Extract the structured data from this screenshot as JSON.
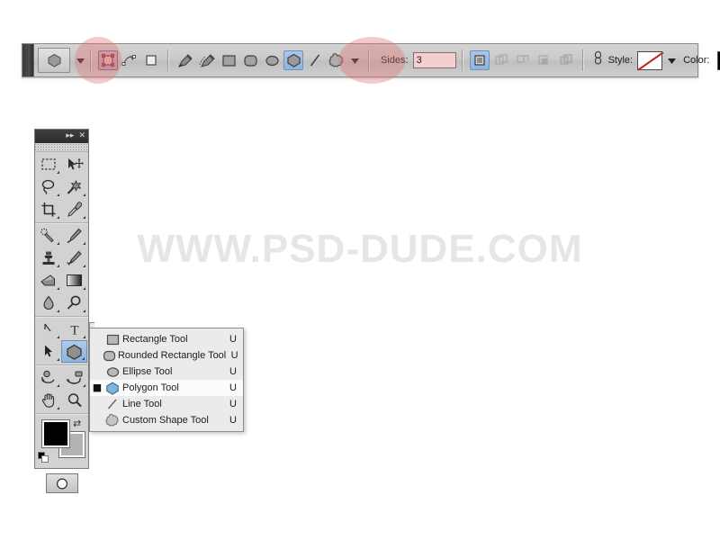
{
  "watermark": {
    "text": "WWW.PSD-DUDE.COM"
  },
  "options_bar": {
    "current_tool_icon": "polygon-shape-icon",
    "tool_preset_caret": "caret-down-icon",
    "shape_modes": [
      {
        "name": "shape-layers-mode",
        "icon": "shape-layer-icon",
        "state": "active",
        "highlighted": true
      },
      {
        "name": "paths-mode",
        "icon": "paths-icon",
        "state": "normal",
        "highlighted": false
      },
      {
        "name": "fill-pixels-mode",
        "icon": "fill-pixels-icon",
        "state": "normal",
        "highlighted": false
      }
    ],
    "tool_buttons": [
      {
        "name": "pen-tool",
        "icon": "pen-icon",
        "state": "normal"
      },
      {
        "name": "freeform-pen-tool",
        "icon": "freeform-pen-icon",
        "state": "normal"
      },
      {
        "name": "rectangle-tool",
        "icon": "rectangle-icon",
        "state": "normal"
      },
      {
        "name": "rounded-rectangle-tool",
        "icon": "rounded-rectangle-icon",
        "state": "normal"
      },
      {
        "name": "ellipse-tool",
        "icon": "ellipse-icon",
        "state": "normal"
      },
      {
        "name": "polygon-tool",
        "icon": "polygon-icon",
        "state": "active"
      },
      {
        "name": "line-tool",
        "icon": "line-icon",
        "state": "normal"
      },
      {
        "name": "custom-shape-tool",
        "icon": "custom-shape-icon",
        "state": "normal"
      }
    ],
    "geometry_caret": "caret-down-icon",
    "sides": {
      "label": "Sides:",
      "value": "3",
      "placeholder": "3",
      "highlighted": true
    },
    "combine_buttons": [
      {
        "name": "add-to-shape-area",
        "icon": "combine-new-icon",
        "state": "active"
      },
      {
        "name": "subtract-from-shape-area",
        "icon": "combine-add-icon",
        "state": "disabled"
      },
      {
        "name": "intersect-shape-areas",
        "icon": "combine-subtract-icon",
        "state": "disabled"
      },
      {
        "name": "exclude-overlapping-shape-areas",
        "icon": "combine-intersect-icon",
        "state": "disabled"
      },
      {
        "name": "combine-exclude",
        "icon": "combine-exclude-icon",
        "state": "disabled"
      }
    ],
    "layer_style_link": {
      "name": "link-styles-icon",
      "icon": "chain-link-icon"
    },
    "style": {
      "label": "Style:",
      "swatch": "none-crossed-out",
      "caret": "caret-down-icon"
    },
    "color": {
      "label": "Color:",
      "value": "#000000"
    }
  },
  "tools_panel": {
    "titlebar": {
      "collapse": "▸▸",
      "close": "✕"
    },
    "groups": [
      {
        "rows": [
          [
            {
              "name": "rectangular-marquee-tool",
              "icon": "marquee-icon",
              "has_flyout": true
            },
            {
              "name": "move-tool",
              "icon": "move-icon",
              "has_flyout": false
            }
          ],
          [
            {
              "name": "lasso-tool",
              "icon": "lasso-icon",
              "has_flyout": true
            },
            {
              "name": "magic-wand-tool",
              "icon": "magic-wand-icon",
              "has_flyout": true
            }
          ],
          [
            {
              "name": "crop-tool",
              "icon": "crop-icon",
              "has_flyout": true
            },
            {
              "name": "eyedropper-tool",
              "icon": "eyedropper-icon",
              "has_flyout": true
            }
          ]
        ]
      },
      {
        "rows": [
          [
            {
              "name": "healing-brush-tool",
              "icon": "healing-brush-icon",
              "has_flyout": true
            },
            {
              "name": "brush-tool",
              "icon": "brush-icon",
              "has_flyout": true
            }
          ],
          [
            {
              "name": "clone-stamp-tool",
              "icon": "clone-stamp-icon",
              "has_flyout": true
            },
            {
              "name": "history-brush-tool",
              "icon": "history-brush-icon",
              "has_flyout": true
            }
          ],
          [
            {
              "name": "eraser-tool",
              "icon": "eraser-icon",
              "has_flyout": true
            },
            {
              "name": "gradient-tool",
              "icon": "gradient-icon",
              "has_flyout": true
            }
          ],
          [
            {
              "name": "blur-tool",
              "icon": "blur-icon",
              "has_flyout": true
            },
            {
              "name": "dodge-tool",
              "icon": "dodge-icon",
              "has_flyout": true
            }
          ]
        ]
      },
      {
        "rows": [
          [
            {
              "name": "path-selection-tool",
              "icon": "pen-path-icon",
              "has_flyout": true
            },
            {
              "name": "type-tool",
              "icon": "type-icon",
              "has_flyout": true
            }
          ],
          [
            {
              "name": "direct-selection-tool",
              "icon": "arrow-select-icon",
              "has_flyout": true
            },
            {
              "name": "shape-tool",
              "icon": "polygon-icon",
              "has_flyout": true,
              "selected": true
            }
          ]
        ]
      },
      {
        "rows": [
          [
            {
              "name": "3d-rotate-tool",
              "icon": "3d-object-rotate-icon",
              "has_flyout": true
            },
            {
              "name": "3d-orbit-tool",
              "icon": "3d-camera-orbit-icon",
              "has_flyout": true
            }
          ],
          [
            {
              "name": "hand-tool",
              "icon": "hand-icon",
              "has_flyout": true
            },
            {
              "name": "zoom-tool",
              "icon": "zoom-magnifier-icon",
              "has_flyout": false
            }
          ]
        ]
      }
    ],
    "colors": {
      "foreground": "#000000",
      "background": "#b3b3b3",
      "swap_icon": "swap-colors-icon",
      "default_icon": "default-colors-icon"
    },
    "quickmask": {
      "name": "quick-mask-mode-icon"
    }
  },
  "flyout_menu": {
    "items": [
      {
        "label": "Rectangle Tool",
        "shortcut": "U",
        "icon": "rectangle-icon",
        "current": false
      },
      {
        "label": "Rounded Rectangle Tool",
        "shortcut": "U",
        "icon": "rounded-rectangle-icon",
        "current": false
      },
      {
        "label": "Ellipse Tool",
        "shortcut": "U",
        "icon": "ellipse-icon",
        "current": false
      },
      {
        "label": "Polygon Tool",
        "shortcut": "U",
        "icon": "polygon-icon",
        "current": true
      },
      {
        "label": "Line Tool",
        "shortcut": "U",
        "icon": "line-icon",
        "current": false
      },
      {
        "label": "Custom Shape Tool",
        "shortcut": "U",
        "icon": "custom-shape-icon",
        "current": false
      }
    ],
    "bullet": "■"
  }
}
